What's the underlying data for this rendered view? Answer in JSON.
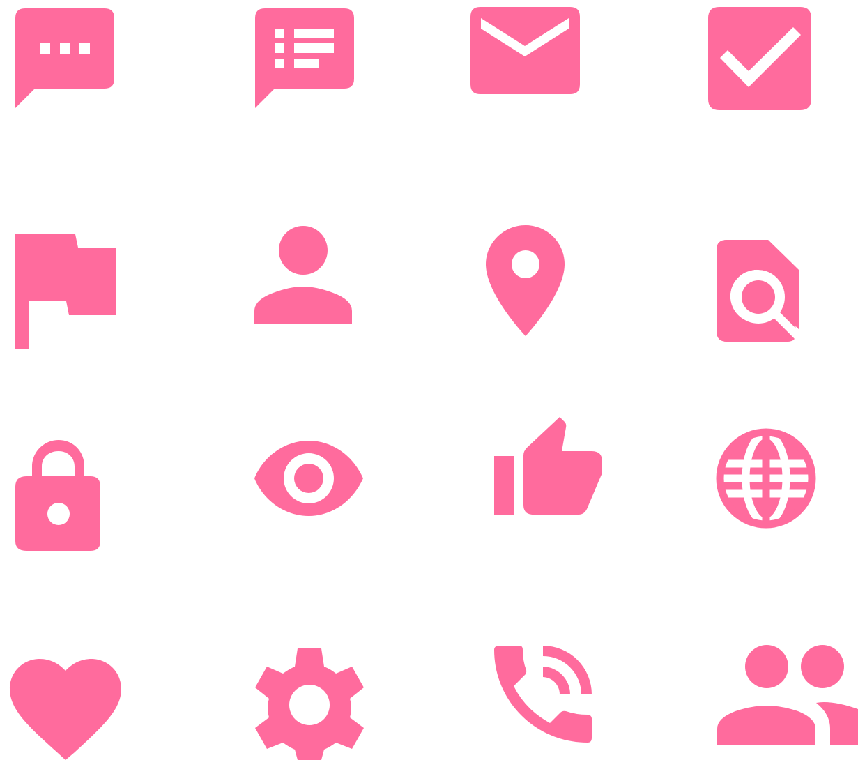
{
  "colors": {
    "icon": "#ff6b9d",
    "background": "#ffffff"
  },
  "icons": [
    "chat-bubble-dots-icon",
    "chat-bubble-list-icon",
    "mail-icon",
    "checkbox-checked-icon",
    "flag-icon",
    "person-icon",
    "location-pin-icon",
    "file-search-icon",
    "lock-icon",
    "eye-icon",
    "thumbs-up-icon",
    "globe-icon",
    "heart-icon",
    "settings-gear-icon",
    "phone-in-talk-icon",
    "people-icon"
  ]
}
